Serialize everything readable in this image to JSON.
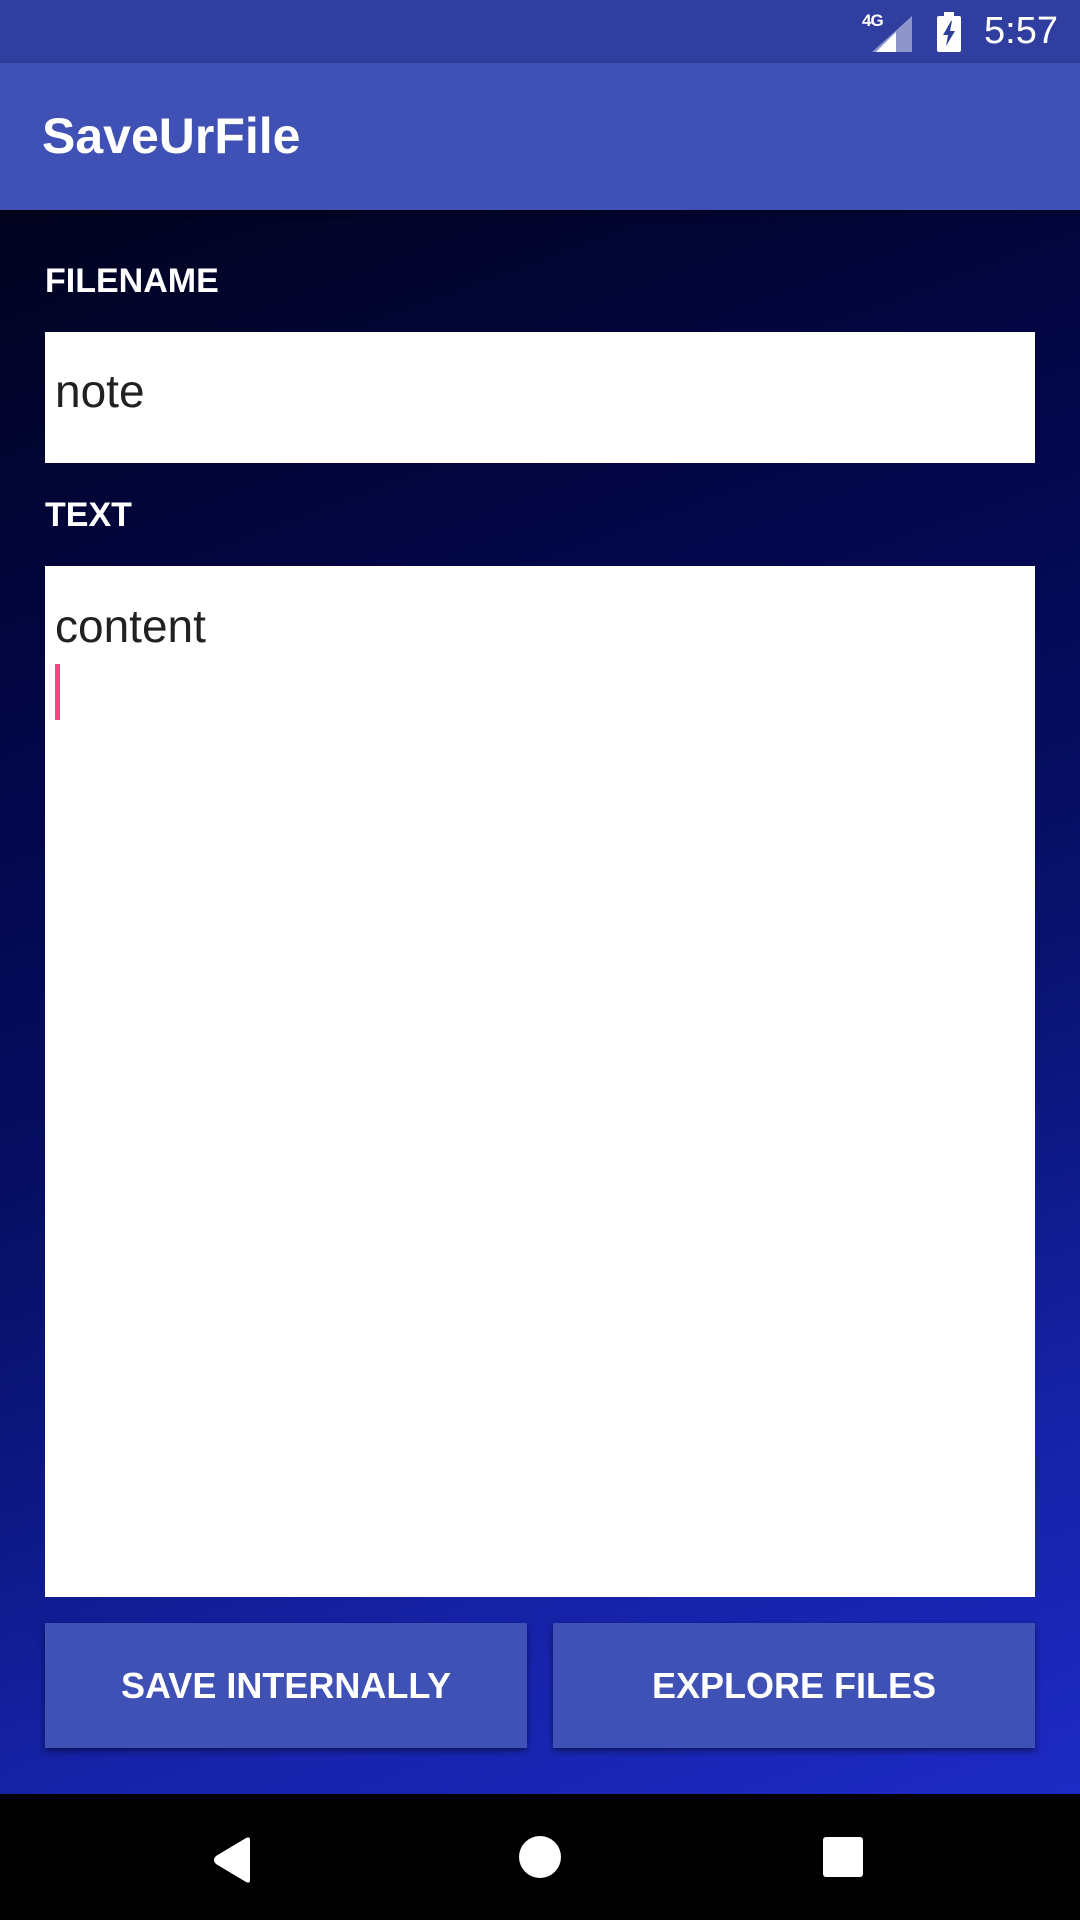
{
  "status_bar": {
    "network": "4G",
    "time": "5:57"
  },
  "app_bar": {
    "title": "SaveUrFile"
  },
  "form": {
    "filename_label": "FILENAME",
    "filename_value": "note",
    "text_label": "TEXT",
    "text_value": "content"
  },
  "buttons": {
    "save_label": "SAVE INTERNALLY",
    "explore_label": "EXPLORE FILES"
  },
  "icons": {
    "signal": "signal-icon",
    "battery": "battery-charging-icon",
    "back": "back-icon",
    "home": "home-icon",
    "recents": "recents-icon"
  },
  "colors": {
    "primary": "#3f51b5",
    "primary_dark": "#303f9f",
    "accent": "#ff4081"
  }
}
